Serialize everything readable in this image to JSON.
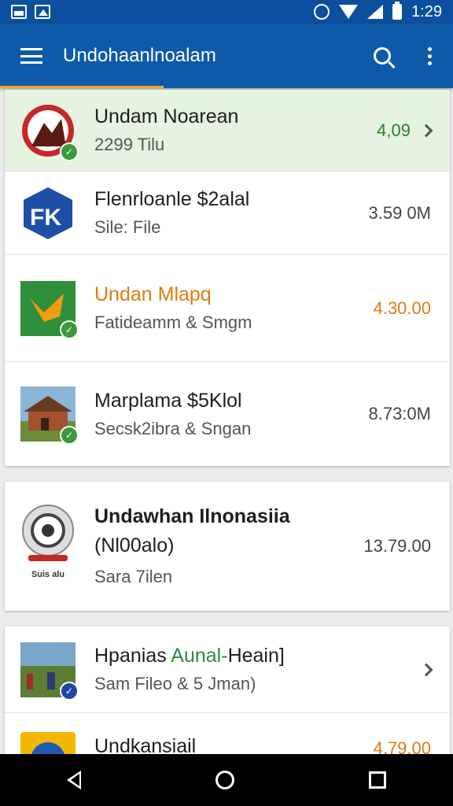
{
  "status_bar": {
    "time": "1:29"
  },
  "app_bar": {
    "title": "Undohaanlnoalam"
  },
  "accent_color": "#0f5aa8",
  "items": [
    {
      "name": "Undam Noarean",
      "sub": "2299 Tilu",
      "price": "4,09",
      "price_color": "#2e7d32",
      "chevron": true,
      "highlight": true,
      "icon": "red-badge-logo-icon"
    },
    {
      "name": "Flenrloanle $2alal",
      "sub": "Sile: File",
      "price": "3.59 0M",
      "icon": "blue-shield-logo-icon"
    },
    {
      "name": "Undan Mlapq",
      "sub": "Fatideamm & Smgm",
      "price": "4.30.00",
      "price_color": "#e07b10",
      "name_color": "#e07b10",
      "icon": "green-flag-icon"
    },
    {
      "name": "Marplama $5Klol",
      "sub": "Secsk2ibra & Sngan",
      "price": "8.73:0M",
      "icon": "house-photo-icon"
    },
    {
      "name": "Undawhan Ilnonasiia",
      "name2": "(Nl00alo)",
      "sub": "Sara 7ilen",
      "price": "13.79.00",
      "icon": "speaker-logo-icon",
      "icon_caption": "Suis alu"
    },
    {
      "name_a": "Hpanias ",
      "name_b": "Aunal-",
      "name_c": "Heain]",
      "sub": "Sam Fileo & 5 Jman)",
      "chevron": true,
      "icon": "village-photo-icon"
    },
    {
      "name": "Undkansiail",
      "price": "4.79.00",
      "price_color": "#e07b10",
      "icon": "yellow-compass-icon"
    }
  ]
}
